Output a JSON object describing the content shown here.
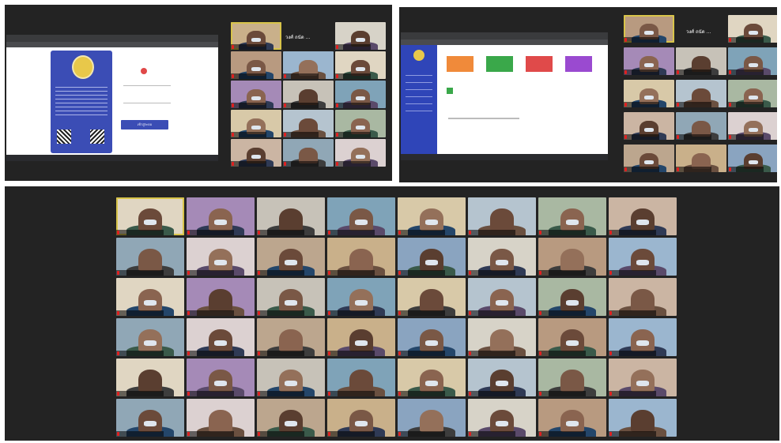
{
  "screens": {
    "top_left": {
      "login_button": "เข้าสู่ระบบ",
      "speaker_label": "วงศ์ ถนัด ..."
    },
    "top_right": {
      "speaker_label": "วงศ์ ถนัด ..."
    }
  },
  "colors": {
    "panel_bg": "#232323",
    "sidebar_blue": "#2f45b8",
    "login_blue": "#3b4db5",
    "active_speaker": "#d8c44a",
    "mic_muted": "#e02020"
  }
}
